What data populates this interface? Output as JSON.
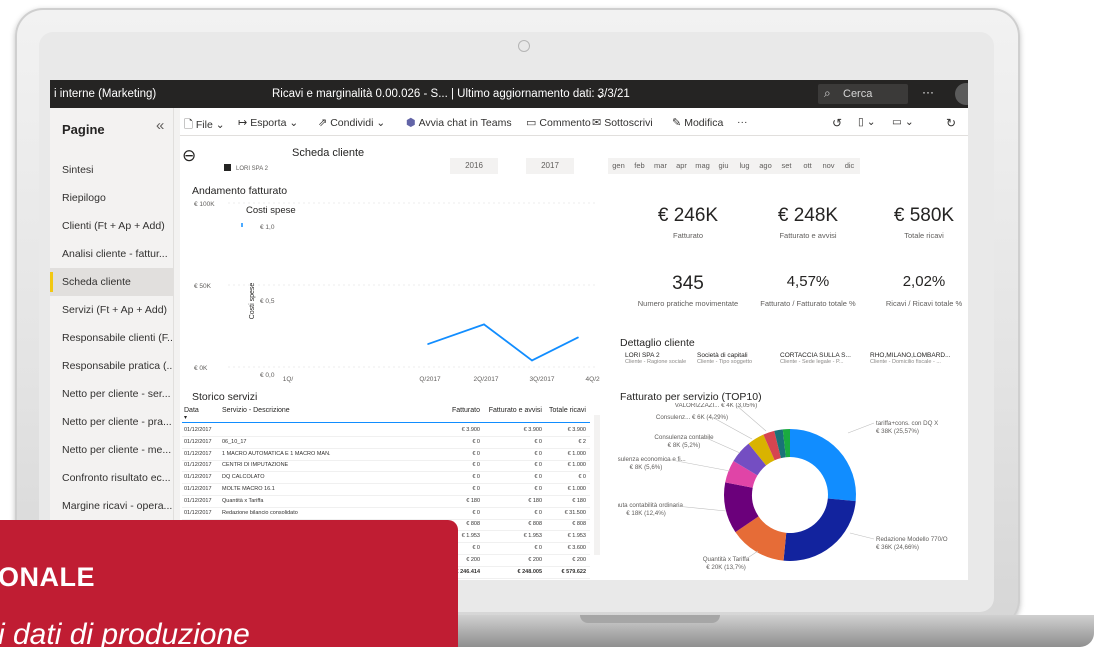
{
  "topbar": {
    "workspace": "i interne (Marketing)",
    "report_title": "Ricavi e marginalità 0.00.026 - S...  |  Ultimo aggiornamento dati: 3/3/21",
    "search_placeholder": "Cerca",
    "more": "···"
  },
  "sidebar": {
    "title": "Pagine",
    "items": [
      "Sintesi",
      "Riepilogo",
      "Clienti (Ft + Ap + Add)",
      "Analisi cliente - fattur...",
      "Scheda cliente",
      "Servizi (Ft + Ap + Add)",
      "Responsabile clienti (F...",
      "Responsabile pratica (...",
      "Netto per cliente - ser...",
      "Netto per cliente - pra...",
      "Netto per cliente - me...",
      "Confronto risultato ec...",
      "Margine ricavi - opera..."
    ],
    "active_index": 4
  },
  "toolbar": {
    "file": "File",
    "esporta": "Esporta",
    "condividi": "Condividi",
    "teams": "Avvia chat in Teams",
    "commento": "Commento",
    "sottoscrivi": "Sottoscrivi",
    "modifica": "Modifica",
    "more": "···"
  },
  "report": {
    "title": "Scheda cliente",
    "client_filter": "LORI SPA 2",
    "years": [
      "2016",
      "2017"
    ],
    "months": [
      "gen",
      "feb",
      "mar",
      "apr",
      "mag",
      "giu",
      "lug",
      "ago",
      "set",
      "ott",
      "nov",
      "dic"
    ],
    "andamento_title": "Andamento fatturato",
    "costi_title": "Costi spese",
    "costi_ylabel": "Costi spese",
    "storico_title": "Storico servizi",
    "dettaglio_title": "Dettaglio cliente",
    "servizio_title": "Fatturato per servizio (TOP10)"
  },
  "kpis": [
    {
      "value": "€ 246K",
      "label": "Fatturato"
    },
    {
      "value": "€ 248K",
      "label": "Fatturato e avvisi"
    },
    {
      "value": "€ 580K",
      "label": "Totale ricavi"
    },
    {
      "value": "345",
      "label": "Numero pratiche movimentate"
    },
    {
      "value": "4,57%",
      "label": "Fatturato / Fatturato totale %"
    },
    {
      "value": "2,02%",
      "label": "Ricavi / Ricavi totale %"
    }
  ],
  "dettaglio": [
    {
      "value": "LORI SPA 2",
      "label": "Cliente - Ragione sociale"
    },
    {
      "value": "Società di capitali",
      "label": "Cliente - Tipo soggetto"
    },
    {
      "value": "CORTACCIA SULLA S...",
      "label": "Cliente - Sede legale - P..."
    },
    {
      "value": "RHO,MILANO,LOMBARD...",
      "label": "Cliente - Domicilio fiscale - ..."
    }
  ],
  "table": {
    "headers": [
      "Data",
      "Servizio - Descrizione",
      "Fatturato",
      "Fatturato e avvisi",
      "Totale ricavi"
    ],
    "rows": [
      [
        "01/12/2017",
        "",
        "€ 3.900",
        "€ 3.900",
        "€ 3.900"
      ],
      [
        "01/12/2017",
        "06_10_17",
        "€ 0",
        "€ 0",
        "€ 2"
      ],
      [
        "01/12/2017",
        "1 MACRO AUTOMATICA E 1 MACRO MAN.",
        "€ 0",
        "€ 0",
        "€ 1.000"
      ],
      [
        "01/12/2017",
        "CENTRI DI IMPUTAZIONE",
        "€ 0",
        "€ 0",
        "€ 1.000"
      ],
      [
        "01/12/2017",
        "DQ CALCOLATO",
        "€ 0",
        "€ 0",
        "€ 0"
      ],
      [
        "01/12/2017",
        "MOLTE MACRO 16.1",
        "€ 0",
        "€ 0",
        "€ 1.000"
      ],
      [
        "01/12/2017",
        "Quantità x Tariffa",
        "€ 180",
        "€ 180",
        "€ 180"
      ],
      [
        "01/12/2017",
        "Redazione bilancio consolidato",
        "€ 0",
        "€ 0",
        "€ 31.500"
      ],
      [
        "",
        "",
        "€ 808",
        "€ 808",
        "€ 808"
      ],
      [
        "",
        "",
        "€ 1.953",
        "€ 1.953",
        "€ 1.953"
      ],
      [
        "",
        "",
        "€ 0",
        "€ 0",
        "€ 3.600"
      ],
      [
        "",
        "",
        "€ 200",
        "€ 200",
        "€ 200"
      ]
    ],
    "totals": [
      "",
      "",
      "€ 246.414",
      "€ 248.005",
      "€ 579.622"
    ]
  },
  "chart_data": [
    {
      "type": "line",
      "title": "Andamento fatturato",
      "x": [
        "1Q/2017",
        "2Q/2017",
        "3Q/2017",
        "4Q/2017"
      ],
      "x_tick_labels": [
        "1Q/",
        "Q/2017",
        "2Q/2017",
        "3Q/2017",
        "4Q/2017"
      ],
      "y_tick_labels": [
        "€ 100K",
        "€ 50K",
        "€ 0K"
      ],
      "series": [
        {
          "values": [
            14000,
            26000,
            4000,
            18000
          ]
        }
      ],
      "ylim": [
        0,
        100000
      ],
      "color": "#118dff"
    },
    {
      "type": "line",
      "title": "Costi spese",
      "ylabel": "Costi spese",
      "y_tick_labels": [
        "€ 1,0",
        "€ 0,5",
        "€ 0,0"
      ],
      "series": [
        {
          "values": []
        }
      ],
      "ylim": [
        0,
        1
      ]
    },
    {
      "type": "pie",
      "title": "Fatturato per servizio (TOP10)",
      "slices": [
        {
          "label": "tariffa+cons. con DQ X",
          "value": 38,
          "amount": "€ 38K (25,57%)",
          "color": "#118dff"
        },
        {
          "label": "Redazione Modello 770/O",
          "value": 36,
          "amount": "€ 36K (24,66%)",
          "color": "#12239e"
        },
        {
          "label": "Quantità x Tariffa",
          "value": 20,
          "amount": "€ 20K (13,7%)",
          "color": "#e66c37"
        },
        {
          "label": "Tenuta contabilità ordinaria",
          "value": 18,
          "amount": "€ 18K (12,4%)",
          "color": "#6b007b"
        },
        {
          "label": "Consulenza economica e fi...",
          "value": 8,
          "amount": "€ 8K (5,6%)",
          "color": "#e044a7"
        },
        {
          "label": "Consulenza contabile",
          "value": 8,
          "amount": "€ 8K (5,2%)",
          "color": "#744ec2"
        },
        {
          "label": "Consulenz...",
          "value": 6,
          "amount": "€ 6K (4,29%)",
          "color": "#d9b300"
        },
        {
          "label": "VALORIZZAZI...",
          "value": 4,
          "amount": "€ 4K (3,05%)",
          "color": "#d64550"
        },
        {
          "label": "",
          "value": 3,
          "amount": "",
          "color": "#197278"
        },
        {
          "label": "",
          "value": 2.5,
          "amount": "",
          "color": "#1aab40"
        }
      ]
    }
  ],
  "banner": {
    "title": "ONALE",
    "subtitle": "i dati di produzione"
  }
}
